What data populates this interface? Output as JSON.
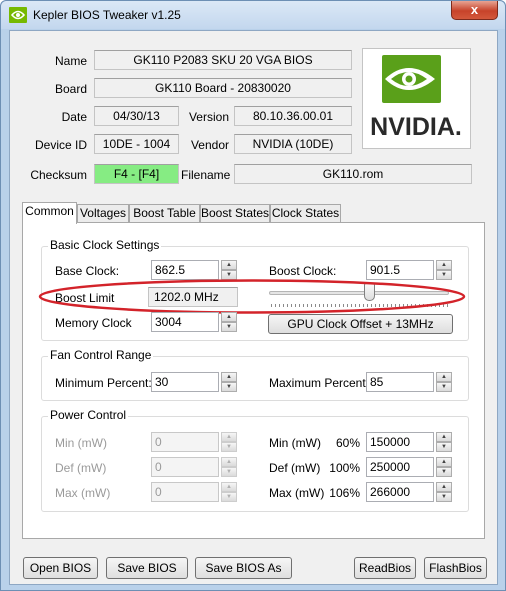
{
  "window": {
    "title": "Kepler BIOS Tweaker v1.25",
    "close_label": "x"
  },
  "info": {
    "name_label": "Name",
    "name_value": "GK110 P2083 SKU 20 VGA BIOS",
    "board_label": "Board",
    "board_value": "GK110 Board - 20830020",
    "date_label": "Date",
    "date_value": "04/30/13",
    "version_label": "Version",
    "version_value": "80.10.36.00.01",
    "device_label": "Device ID",
    "device_value": "10DE - 1004",
    "vendor_label": "Vendor",
    "vendor_value": "NVIDIA (10DE)",
    "checksum_label": "Checksum",
    "checksum_value": "F4 - [F4]",
    "filename_label": "Filename",
    "filename_value": "GK110.rom"
  },
  "logo": {
    "icon": "nvidia-logo",
    "wordmark": "NVIDIA."
  },
  "tabs": [
    "Common",
    "Voltages",
    "Boost Table",
    "Boost States",
    "Clock States"
  ],
  "clock": {
    "title": "Basic Clock Settings",
    "base_label": "Base Clock:",
    "base_value": "862.5",
    "boost_label": "Boost Clock:",
    "boost_value": "901.5",
    "limit_label": "Boost Limit",
    "limit_value": "1202.0 MHz",
    "memory_label": "Memory Clock",
    "memory_value": "3004",
    "offset_button": "GPU Clock Offset + 13MHz",
    "slider_level": 0.56
  },
  "fan": {
    "title": "Fan Control Range",
    "min_label": "Minimum Percent:",
    "min_value": "30",
    "max_label": "Maximum Percent:",
    "max_value": "85"
  },
  "power": {
    "title": "Power Control",
    "left_rows": [
      {
        "label": "Min (mW)",
        "value": "0"
      },
      {
        "label": "Def (mW)",
        "value": "0"
      },
      {
        "label": "Max (mW)",
        "value": "0"
      }
    ],
    "right_rows": [
      {
        "label": "Min (mW)",
        "percent": "60%",
        "value": "150000"
      },
      {
        "label": "Def (mW)",
        "percent": "100%",
        "value": "250000"
      },
      {
        "label": "Max (mW)",
        "percent": "106%",
        "value": "266000"
      }
    ]
  },
  "buttons": {
    "open": "Open BIOS",
    "save": "Save BIOS",
    "save_as": "Save BIOS As",
    "read": "ReadBios",
    "flash": "FlashBios"
  },
  "colors": {
    "checksum_ok": "#86ec83",
    "annotation": "#d3232a",
    "nvidia_green": "#76b900"
  }
}
